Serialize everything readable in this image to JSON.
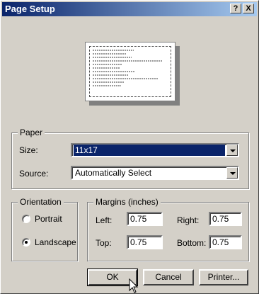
{
  "window": {
    "title": "Page Setup"
  },
  "titlebar": {
    "help_label": "?",
    "close_label": "X"
  },
  "paper": {
    "group_label": "Paper",
    "size_label": "Size:",
    "size_value": "11x17",
    "source_label": "Source:",
    "source_value": "Automatically Select"
  },
  "orientation": {
    "group_label": "Orientation",
    "options": [
      {
        "label": "Portrait",
        "selected": false
      },
      {
        "label": "Landscape",
        "selected": true
      }
    ]
  },
  "margins": {
    "group_label": "Margins (inches)",
    "left_label": "Left:",
    "left_value": "0.75",
    "right_label": "Right:",
    "right_value": "0.75",
    "top_label": "Top:",
    "top_value": "0.75",
    "bottom_label": "Bottom:",
    "bottom_value": "0.75"
  },
  "buttons": {
    "ok": "OK",
    "cancel": "Cancel",
    "printer": "Printer..."
  },
  "colors": {
    "title_bar": "#0a246a",
    "face": "#d4d0c8",
    "selection": "#0a246a"
  },
  "icons": [
    "help-icon",
    "close-icon",
    "dropdown-arrow-icon",
    "mouse-pointer-icon"
  ]
}
